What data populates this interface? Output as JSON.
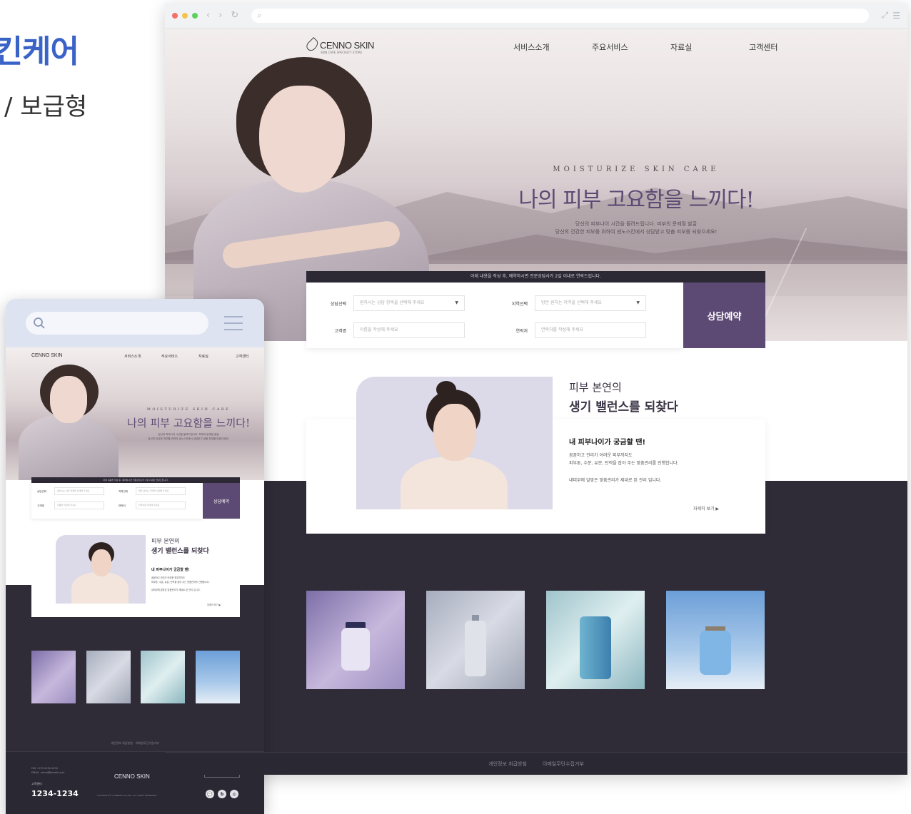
{
  "heading": {
    "title": "스킨케어",
    "subtitle": "/ 보급형"
  },
  "site": {
    "brand": "CENNO SKIN",
    "brand_tag": "SKIN CARE SPECIALTY STORE",
    "menu": [
      "서비스소개",
      "주요서비스",
      "자료실",
      "고객센터"
    ],
    "hero": {
      "eyebrow": "MOISTURIZE SKIN CARE",
      "title": "나의 피부 고요함을 느끼다!",
      "desc": [
        "당신의 피부나이 시간을 돌려드립니다. 피부의 문제점 발굴",
        "당신의 건강한 피부를 위하여 센노스킨에서 상담받고 맞춤 피부를 되찾으세요!"
      ]
    },
    "booking": {
      "notice": "아래 내용을 작성 후, 예약하시면 전문상담사가 2일 이내로 연락드립니다.",
      "fields": [
        {
          "label": "상담선택",
          "placeholder": "원하시는 상담 항목을 선택해 주세요",
          "type": "select"
        },
        {
          "label": "지역선택",
          "placeholder": "방문 원하는 지역을 선택해 주세요",
          "type": "select"
        },
        {
          "label": "고객명",
          "placeholder": "이름을 작성해 주세요",
          "type": "text"
        },
        {
          "label": "연락처",
          "placeholder": "연락처를 작성해 주세요",
          "type": "text"
        }
      ],
      "button": "상담예약"
    },
    "balance": {
      "title_line1": "피부 본연의",
      "title_line2": "생기 밸런스를 되찾다",
      "card_title": "내 피부나이가 궁금할 땐!",
      "card_text": [
        "꼼꼼하고 관리가 어려운 피부까지도",
        "피부톤, 수분, 유분, 탄력을 잡아 주는 맞춤관리를 진행합니다.",
        "내피부에 알맞은 맞춤관리가 제대로 된 관리 입니다."
      ],
      "more": "자세히 보기 ▶"
    },
    "products": [
      "product-1",
      "product-2",
      "product-3",
      "product-4"
    ],
    "footer_links": [
      "개인정보 취급방침",
      "이메일무단수집거부"
    ],
    "footer": {
      "contact": [
        "FAX : 070-1234-1234",
        "EMAIL : email@email.co.kr"
      ],
      "center_label": "고객센터",
      "phone": "1234-1234",
      "copyright": "COPYRIGHT© COMPANY CO.,INC. ALL RIGHT RESERVED.",
      "family_site": "FAMILY SITE",
      "social": [
        "💬",
        "b",
        "◎"
      ]
    }
  },
  "colors": {
    "accent": "#5d4a74",
    "dark": "#2f2c38",
    "heading": "#3a63c8"
  }
}
